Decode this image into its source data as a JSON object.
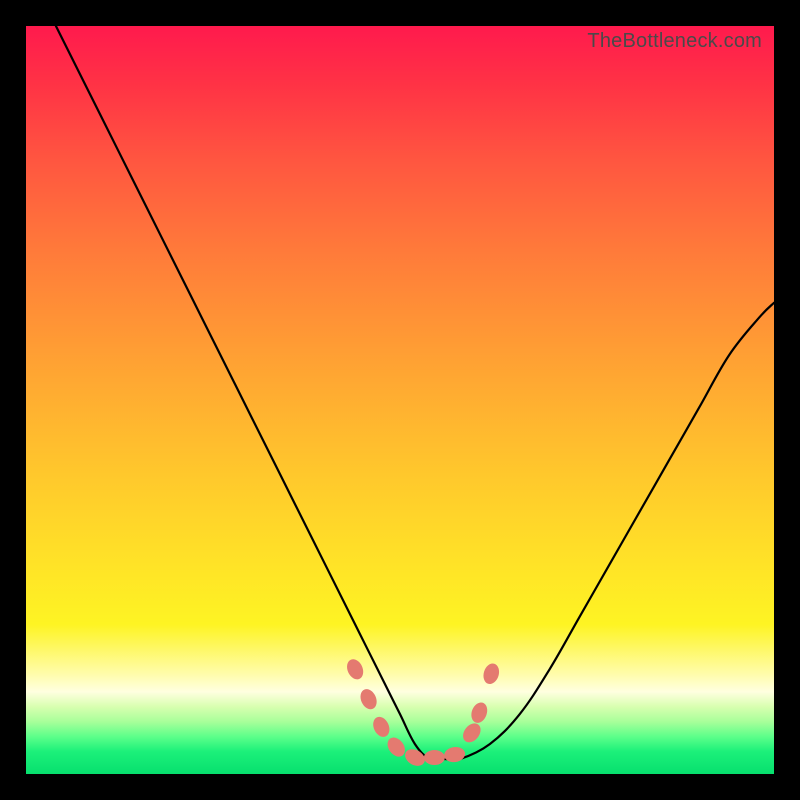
{
  "watermark": "TheBottleneck.com",
  "colors": {
    "background": "#000000",
    "gradient_top": "#ff1a4d",
    "gradient_bottom": "#07e06e",
    "curve": "#000000",
    "markers": "#e47a70"
  },
  "chart_data": {
    "type": "line",
    "title": "",
    "xlabel": "",
    "ylabel": "",
    "xlim": [
      0,
      100
    ],
    "ylim": [
      0,
      100
    ],
    "series": [
      {
        "name": "bottleneck-curve",
        "x": [
          4,
          8,
          12,
          16,
          20,
          24,
          28,
          32,
          36,
          40,
          44,
          46,
          48,
          50,
          52,
          54,
          56,
          58,
          62,
          66,
          70,
          74,
          78,
          82,
          86,
          90,
          94,
          98,
          100
        ],
        "y": [
          100,
          92,
          84,
          76,
          68,
          60,
          52,
          44,
          36,
          28,
          20,
          16,
          12,
          8,
          4,
          2,
          2,
          2,
          4,
          8,
          14,
          21,
          28,
          35,
          42,
          49,
          56,
          61,
          63
        ]
      }
    ],
    "markers": {
      "name": "highlight-points",
      "x": [
        44.0,
        45.8,
        47.5,
        49.5,
        52.0,
        54.6,
        57.3,
        59.6,
        60.6,
        62.2
      ],
      "y": [
        14.0,
        10.0,
        6.3,
        3.6,
        2.2,
        2.2,
        2.6,
        5.5,
        8.2,
        13.4
      ]
    }
  }
}
